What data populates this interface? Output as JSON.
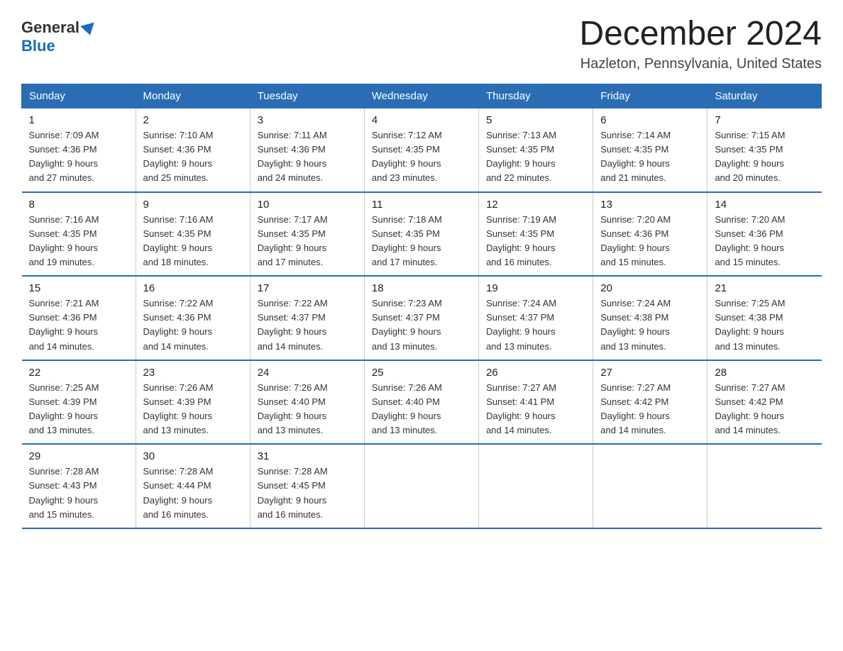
{
  "logo": {
    "general": "General",
    "blue": "Blue"
  },
  "title": "December 2024",
  "subtitle": "Hazleton, Pennsylvania, United States",
  "days_of_week": [
    "Sunday",
    "Monday",
    "Tuesday",
    "Wednesday",
    "Thursday",
    "Friday",
    "Saturday"
  ],
  "weeks": [
    [
      {
        "day": "1",
        "sunrise": "7:09 AM",
        "sunset": "4:36 PM",
        "daylight": "9 hours and 27 minutes."
      },
      {
        "day": "2",
        "sunrise": "7:10 AM",
        "sunset": "4:36 PM",
        "daylight": "9 hours and 25 minutes."
      },
      {
        "day": "3",
        "sunrise": "7:11 AM",
        "sunset": "4:36 PM",
        "daylight": "9 hours and 24 minutes."
      },
      {
        "day": "4",
        "sunrise": "7:12 AM",
        "sunset": "4:35 PM",
        "daylight": "9 hours and 23 minutes."
      },
      {
        "day": "5",
        "sunrise": "7:13 AM",
        "sunset": "4:35 PM",
        "daylight": "9 hours and 22 minutes."
      },
      {
        "day": "6",
        "sunrise": "7:14 AM",
        "sunset": "4:35 PM",
        "daylight": "9 hours and 21 minutes."
      },
      {
        "day": "7",
        "sunrise": "7:15 AM",
        "sunset": "4:35 PM",
        "daylight": "9 hours and 20 minutes."
      }
    ],
    [
      {
        "day": "8",
        "sunrise": "7:16 AM",
        "sunset": "4:35 PM",
        "daylight": "9 hours and 19 minutes."
      },
      {
        "day": "9",
        "sunrise": "7:16 AM",
        "sunset": "4:35 PM",
        "daylight": "9 hours and 18 minutes."
      },
      {
        "day": "10",
        "sunrise": "7:17 AM",
        "sunset": "4:35 PM",
        "daylight": "9 hours and 17 minutes."
      },
      {
        "day": "11",
        "sunrise": "7:18 AM",
        "sunset": "4:35 PM",
        "daylight": "9 hours and 17 minutes."
      },
      {
        "day": "12",
        "sunrise": "7:19 AM",
        "sunset": "4:35 PM",
        "daylight": "9 hours and 16 minutes."
      },
      {
        "day": "13",
        "sunrise": "7:20 AM",
        "sunset": "4:36 PM",
        "daylight": "9 hours and 15 minutes."
      },
      {
        "day": "14",
        "sunrise": "7:20 AM",
        "sunset": "4:36 PM",
        "daylight": "9 hours and 15 minutes."
      }
    ],
    [
      {
        "day": "15",
        "sunrise": "7:21 AM",
        "sunset": "4:36 PM",
        "daylight": "9 hours and 14 minutes."
      },
      {
        "day": "16",
        "sunrise": "7:22 AM",
        "sunset": "4:36 PM",
        "daylight": "9 hours and 14 minutes."
      },
      {
        "day": "17",
        "sunrise": "7:22 AM",
        "sunset": "4:37 PM",
        "daylight": "9 hours and 14 minutes."
      },
      {
        "day": "18",
        "sunrise": "7:23 AM",
        "sunset": "4:37 PM",
        "daylight": "9 hours and 13 minutes."
      },
      {
        "day": "19",
        "sunrise": "7:24 AM",
        "sunset": "4:37 PM",
        "daylight": "9 hours and 13 minutes."
      },
      {
        "day": "20",
        "sunrise": "7:24 AM",
        "sunset": "4:38 PM",
        "daylight": "9 hours and 13 minutes."
      },
      {
        "day": "21",
        "sunrise": "7:25 AM",
        "sunset": "4:38 PM",
        "daylight": "9 hours and 13 minutes."
      }
    ],
    [
      {
        "day": "22",
        "sunrise": "7:25 AM",
        "sunset": "4:39 PM",
        "daylight": "9 hours and 13 minutes."
      },
      {
        "day": "23",
        "sunrise": "7:26 AM",
        "sunset": "4:39 PM",
        "daylight": "9 hours and 13 minutes."
      },
      {
        "day": "24",
        "sunrise": "7:26 AM",
        "sunset": "4:40 PM",
        "daylight": "9 hours and 13 minutes."
      },
      {
        "day": "25",
        "sunrise": "7:26 AM",
        "sunset": "4:40 PM",
        "daylight": "9 hours and 13 minutes."
      },
      {
        "day": "26",
        "sunrise": "7:27 AM",
        "sunset": "4:41 PM",
        "daylight": "9 hours and 14 minutes."
      },
      {
        "day": "27",
        "sunrise": "7:27 AM",
        "sunset": "4:42 PM",
        "daylight": "9 hours and 14 minutes."
      },
      {
        "day": "28",
        "sunrise": "7:27 AM",
        "sunset": "4:42 PM",
        "daylight": "9 hours and 14 minutes."
      }
    ],
    [
      {
        "day": "29",
        "sunrise": "7:28 AM",
        "sunset": "4:43 PM",
        "daylight": "9 hours and 15 minutes."
      },
      {
        "day": "30",
        "sunrise": "7:28 AM",
        "sunset": "4:44 PM",
        "daylight": "9 hours and 16 minutes."
      },
      {
        "day": "31",
        "sunrise": "7:28 AM",
        "sunset": "4:45 PM",
        "daylight": "9 hours and 16 minutes."
      },
      null,
      null,
      null,
      null
    ]
  ],
  "labels": {
    "sunrise": "Sunrise:",
    "sunset": "Sunset:",
    "daylight": "Daylight:"
  },
  "colors": {
    "header_bg": "#2a6db5",
    "border": "#2a6db5"
  }
}
